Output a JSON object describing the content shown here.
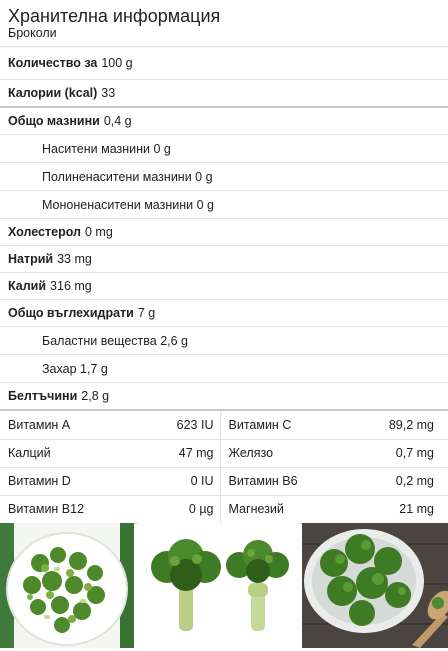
{
  "header": {
    "title": "Хранителна информация",
    "subtitle": "Броколи"
  },
  "rows": {
    "quantity": {
      "label": "Количество за",
      "value": "100 g"
    },
    "calories": {
      "label": "Калории (kcal)",
      "value": "33"
    },
    "fat": {
      "label": "Общо мазнини",
      "value": "0,4 g"
    },
    "saturated": {
      "label": "Наситени мазнини",
      "value": "0 g"
    },
    "polyunsaturated": {
      "label": "Полиненаситени мазнини",
      "value": "0 g"
    },
    "monounsaturated": {
      "label": "Мононенаситени мазнини",
      "value": "0 g"
    },
    "cholesterol": {
      "label": "Холестерол",
      "value": "0 mg"
    },
    "sodium": {
      "label": "Натрий",
      "value": "33 mg"
    },
    "potassium": {
      "label": "Калий",
      "value": "316 mg"
    },
    "carbs": {
      "label": "Общо въглехидрати",
      "value": "7 g"
    },
    "fiber": {
      "label": "Баластни вещества",
      "value": "2,6 g"
    },
    "sugar": {
      "label": "Захар",
      "value": "1,7 g"
    },
    "protein": {
      "label": "Белтъчини",
      "value": "2,8 g"
    }
  },
  "vitamins": [
    {
      "left_name": "Витамин A",
      "left_value": "623 IU",
      "right_name": "Витамин C",
      "right_value": "89,2 mg"
    },
    {
      "left_name": "Калций",
      "left_value": "47 mg",
      "right_name": "Желязо",
      "right_value": "0,7 mg"
    },
    {
      "left_name": "Витамин D",
      "left_value": "0 IU",
      "right_name": "Витамин B6",
      "right_value": "0,2 mg"
    },
    {
      "left_name": "Витамин B12",
      "left_value": "0 µg",
      "right_name": "Магнезий",
      "right_value": "21 mg"
    }
  ],
  "colors": {
    "broccoli_green": "#5a8f2e",
    "broccoli_dark": "#2f5e1a",
    "stem_green": "#b9cf86",
    "row_border": "#e4e4e4"
  }
}
